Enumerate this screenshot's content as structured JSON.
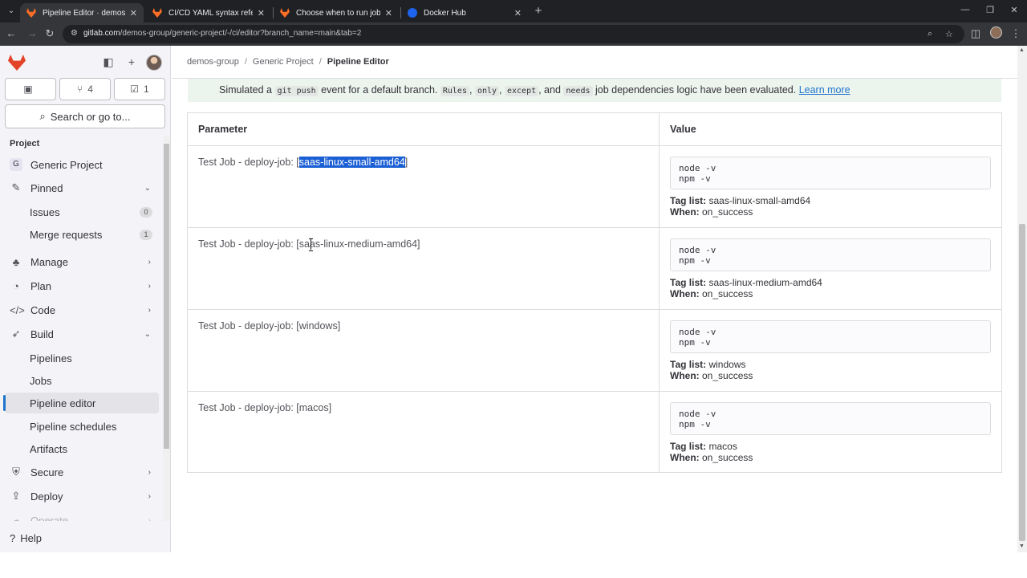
{
  "browser": {
    "tabs": [
      {
        "title": "Pipeline Editor · demos-group /",
        "active": true,
        "favicon": "gitlab-icon"
      },
      {
        "title": "CI/CD YAML syntax reference |",
        "active": false,
        "favicon": "gitlab-icon"
      },
      {
        "title": "Choose when to run jobs | Git",
        "active": false,
        "favicon": "gitlab-icon"
      },
      {
        "title": "Docker Hub",
        "active": false,
        "favicon": "docker-icon"
      }
    ],
    "url_host": "gitlab.com",
    "url_path": "/demos-group/generic-project/-/ci/editor?branch_name=main&tab=2"
  },
  "sidebar": {
    "counters": {
      "merge_requests": "4",
      "todos": "1"
    },
    "search_label": "Search or go to...",
    "section_heading": "Project",
    "project_name": "Generic Project",
    "project_initial": "G",
    "pinned_label": "Pinned",
    "pinned_items": [
      {
        "label": "Issues",
        "count": "0"
      },
      {
        "label": "Merge requests",
        "count": "1"
      }
    ],
    "groups": {
      "manage": "Manage",
      "plan": "Plan",
      "code": "Code",
      "build": "Build",
      "secure": "Secure",
      "deploy": "Deploy",
      "operate": "Operate"
    },
    "build_items": [
      "Pipelines",
      "Jobs",
      "Pipeline editor",
      "Pipeline schedules",
      "Artifacts"
    ],
    "help_label": "Help"
  },
  "breadcrumb": [
    "demos-group",
    "Generic Project",
    "Pipeline Editor"
  ],
  "alert": {
    "text_start": "Simulated a",
    "code_git_push": "git push",
    "text_mid": "event for a default branch.",
    "code_rules": "Rules",
    "code_only": "only",
    "code_except": "except",
    "text_and": ", and",
    "code_needs": "needs",
    "text_end": "job dependencies logic have been evaluated.",
    "link": "Learn more"
  },
  "table": {
    "headers": {
      "parameter": "Parameter",
      "value": "Value"
    },
    "tag_list_label": "Tag list:",
    "when_label": "When:",
    "rows": [
      {
        "prefix": "Test Job - deploy-job: [",
        "job": "saas-linux-small-amd64",
        "suffix": "]",
        "script": [
          "node -v",
          "npm -v"
        ],
        "tag_list": "saas-linux-small-amd64",
        "when": "on_success"
      },
      {
        "prefix": "Test Job - deploy-job: [",
        "job": "saas-linux-medium-amd64",
        "suffix": "]",
        "script": [
          "node -v",
          "npm -v"
        ],
        "tag_list": "saas-linux-medium-amd64",
        "when": "on_success"
      },
      {
        "prefix": "Test Job - deploy-job: [",
        "job": "windows",
        "suffix": "]",
        "script": [
          "node -v",
          "npm -v"
        ],
        "tag_list": "windows",
        "when": "on_success"
      },
      {
        "prefix": "Test Job - deploy-job: [",
        "job": "macos",
        "suffix": "]",
        "script": [
          "node -v",
          "npm -v"
        ],
        "tag_list": "macos",
        "when": "on_success"
      }
    ]
  },
  "colors": {
    "accent": "#1f75cb",
    "selection": "#1a5fd4",
    "alert_bg": "#ecf4ee",
    "sidebar_bg": "#f4f3f7"
  }
}
